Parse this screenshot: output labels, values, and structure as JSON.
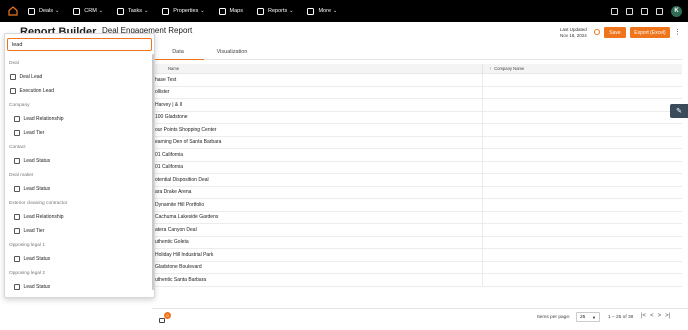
{
  "nav": {
    "items": [
      {
        "label": "Deals",
        "icon": "deals-icon",
        "dropdown": true
      },
      {
        "label": "CRM",
        "icon": "crm-icon",
        "dropdown": true
      },
      {
        "label": "Tasks",
        "icon": "tasks-icon",
        "dropdown": true
      },
      {
        "label": "Properties",
        "icon": "properties-icon",
        "dropdown": true
      },
      {
        "label": "Maps",
        "icon": "maps-icon",
        "dropdown": false
      },
      {
        "label": "Reports",
        "icon": "reports-icon",
        "dropdown": true
      },
      {
        "label": "More",
        "icon": "more-icon",
        "dropdown": true
      }
    ],
    "avatar": "K"
  },
  "page": {
    "builder_title": "Report Builder",
    "report_title": "Deal Engagement Report",
    "last_updated_label": "Last Updated",
    "last_updated_value": "Nov 18, 2024",
    "save_label": "Save",
    "export_label": "Export (Excel)"
  },
  "tabs": [
    "Data",
    "Visualization"
  ],
  "table": {
    "headers": [
      "Name",
      "Company Name"
    ],
    "rows": [
      "hase Test",
      "ollister",
      "Harvey | & II",
      "100 Gladstone",
      "our Points Shopping Center",
      "earning Den of Santa Barbara",
      "01 California",
      "01 California",
      "otential Disposition Deal",
      "ara Drake Arena",
      "Dynamite Hill Portfolio",
      "Cachuma Lakeside Gardens",
      "atera Canyon Deal",
      "uthentic Goleta",
      "Holiday Hill Industrial Park",
      "Gladstone Boulevard",
      "uthentic Santa Barbara"
    ]
  },
  "footer": {
    "badge": "0",
    "items_per_page_label": "Items per page:",
    "items_per_page_value": "25",
    "range": "1 – 25 of 38"
  },
  "panel": {
    "search_value": "lead",
    "groups": [
      {
        "label": "Deal",
        "items": [
          {
            "label": "Deal Lead",
            "level": 1
          },
          {
            "label": "Execution Lead",
            "level": 1
          }
        ]
      },
      {
        "label": "Company",
        "items": [
          {
            "label": "Lead Relationship",
            "level": 2
          },
          {
            "label": "Lead Tier",
            "level": 2
          }
        ]
      },
      {
        "label": "Contact",
        "items": [
          {
            "label": "Lead Status",
            "level": 2
          }
        ]
      },
      {
        "label": "Deal maker",
        "items": [
          {
            "label": "Lead Status",
            "level": 2
          }
        ]
      },
      {
        "label": "Exterior cleaning contractor",
        "items": [
          {
            "label": "Lead Relationship",
            "level": 2
          },
          {
            "label": "Lead Tier",
            "level": 2
          }
        ]
      },
      {
        "label": "Opposing legal 1",
        "items": [
          {
            "label": "Lead Status",
            "level": 2
          }
        ]
      },
      {
        "label": "Opposing legal 2",
        "items": [
          {
            "label": "Lead Status",
            "level": 2
          }
        ]
      }
    ]
  },
  "colors": {
    "accent": "#f0741c",
    "topbar": "#000000"
  }
}
